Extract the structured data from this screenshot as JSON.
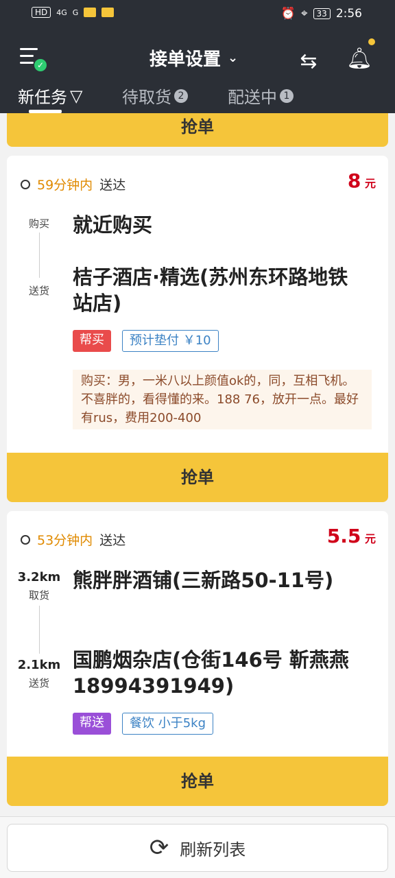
{
  "status_bar": {
    "left_items": [
      "HD",
      "4G",
      "G"
    ],
    "battery": "33",
    "time": "2:56"
  },
  "header": {
    "title": "接单设置",
    "menu_icon": "menu-check-icon",
    "route_icon": "route-icon",
    "bell_icon": "bell-icon",
    "tabs": [
      {
        "label": "新任务",
        "filter_glyph": "▽",
        "badge": ""
      },
      {
        "label": "待取货",
        "badge": "2"
      },
      {
        "label": "配送中",
        "badge": "1"
      }
    ]
  },
  "top_button": {
    "label": "抢单"
  },
  "orders": [
    {
      "eta_minutes": "59分钟内",
      "eta_suffix": "送达",
      "price": "8",
      "price_unit": "元",
      "pickup_label": "购买",
      "pickup_distance": "",
      "pickup_address": "就近购买",
      "delivery_label": "送货",
      "delivery_distance": "",
      "delivery_address": "桔子酒店·精选(苏州东环路地铁站店)",
      "tags": [
        "帮买",
        "预计垫付 ￥10"
      ],
      "note": "购买：男，一米八以上颜值ok的，同，互相飞机。不喜胖的，看得懂的来。188 76，放开一点。最好有rus，费用200-400",
      "button": "抢单"
    },
    {
      "eta_minutes": "53分钟内",
      "eta_suffix": "送达",
      "price": "5.5",
      "price_unit": "元",
      "pickup_label": "取货",
      "pickup_distance": "3.2km",
      "pickup_address": "熊胖胖酒铺(三新路50-11号)",
      "delivery_label": "送货",
      "delivery_distance": "2.1km",
      "delivery_address": "国鹏烟杂店(仓街146号 靳燕燕 18994391949)",
      "tags": [
        "帮送",
        "餐饮 小于5kg"
      ],
      "button": "抢单"
    }
  ],
  "bottom": {
    "refresh_label": "刷新列表"
  },
  "colors": {
    "header_bg": "#2b2f36",
    "accent_yellow": "#f5c53a",
    "price_red": "#d0021b",
    "eta_orange": "#e08a00",
    "tag_blue": "#3b82c4",
    "tag_red": "#e94b4b",
    "tag_purple": "#9a4fd8"
  }
}
